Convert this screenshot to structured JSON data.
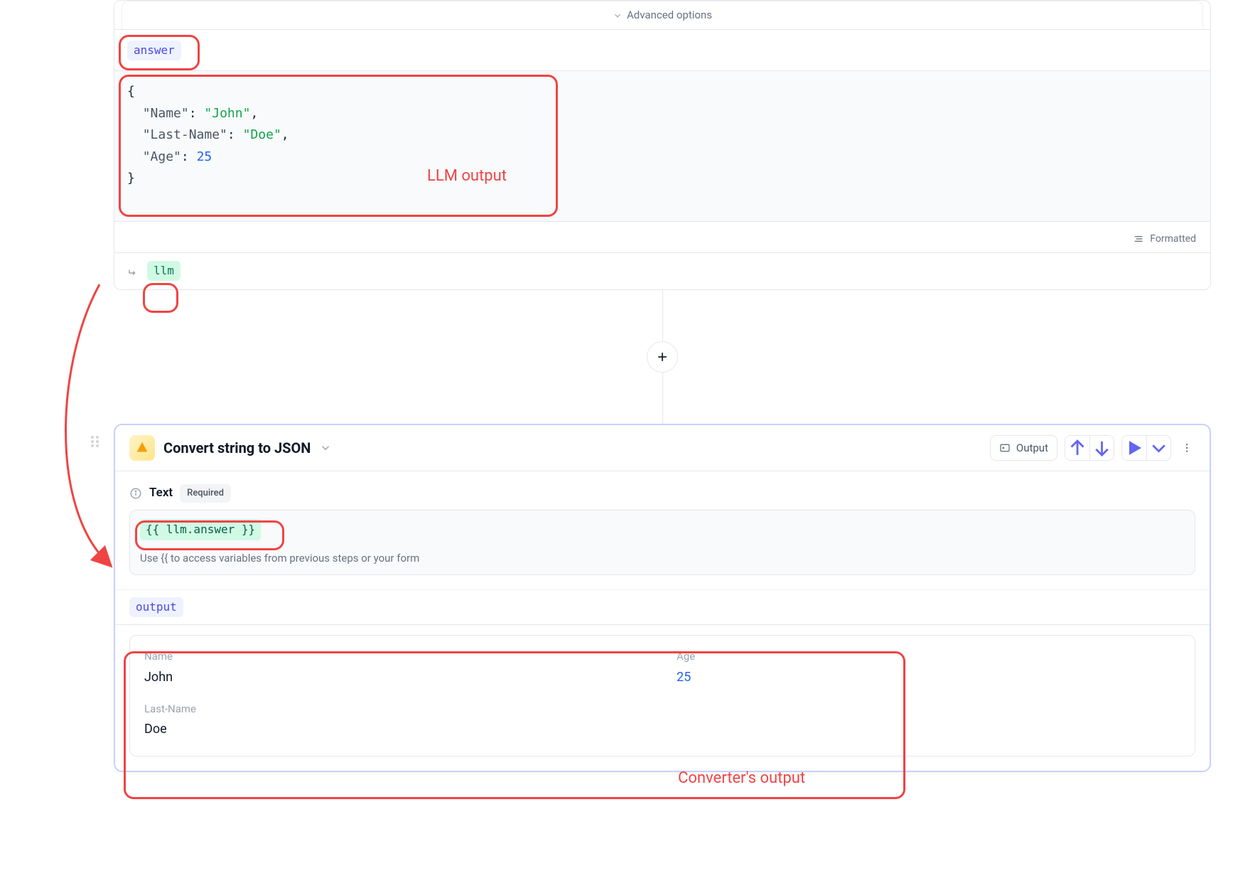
{
  "top": {
    "advanced_label": "Advanced options",
    "answer_chip": "answer",
    "formatted_label": "Formatted",
    "llm_chip": "llm",
    "code": {
      "key_name": "\"Name\"",
      "val_name": "\"John\"",
      "key_last": "\"Last-Name\"",
      "val_last": "\"Doe\"",
      "key_age": "\"Age\"",
      "val_age": "25"
    }
  },
  "annotations": {
    "llm_output": "LLM output",
    "converter_output": "Converter's output"
  },
  "add_button": "+",
  "convert": {
    "title": "Convert string to JSON",
    "output_button": "Output",
    "text_label": "Text",
    "required_badge": "Required",
    "template_value": "{{ llm.answer }}",
    "hint": "Use {{ to access variables from previous steps or your form",
    "output_chip": "output",
    "fields": {
      "name_label": "Name",
      "name_value": "John",
      "age_label": "Age",
      "age_value": "25",
      "last_label": "Last-Name",
      "last_value": "Doe"
    }
  }
}
